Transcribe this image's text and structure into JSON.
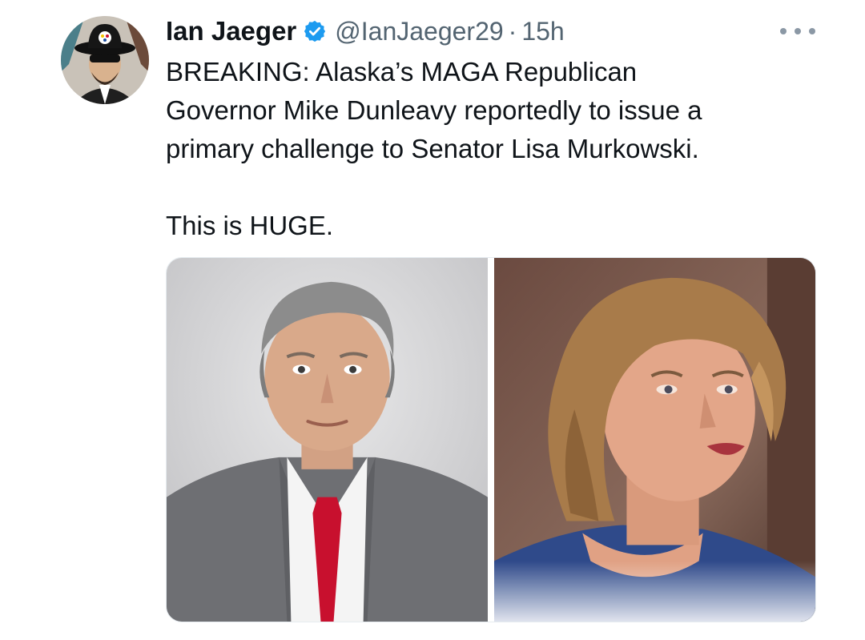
{
  "tweet": {
    "author_name": "Ian Jaeger",
    "handle": "@IanJaeger29",
    "separator": "·",
    "time": "15h",
    "text_lines": [
      "BREAKING: Alaska’s MAGA Republican",
      "Governor Mike Dunleavy reportedly to issue a",
      "primary challenge to Senator Lisa Murkowski."
    ],
    "text_last": "This is HUGE."
  },
  "icons": {
    "verified": "verified-badge-icon",
    "more": "more-options-icon"
  },
  "colors": {
    "verified_blue": "#1d9bf0",
    "secondary_text": "#536471",
    "primary_text": "#0f1419",
    "tie_red": "#c8102e"
  },
  "media": {
    "count": 2
  }
}
